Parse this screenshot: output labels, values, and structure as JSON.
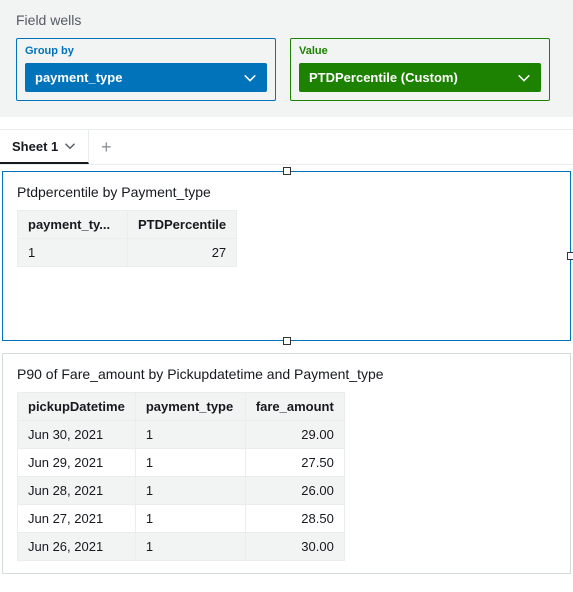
{
  "fieldWells": {
    "title": "Field wells",
    "groupBy": {
      "label": "Group by",
      "value": "payment_type"
    },
    "value": {
      "label": "Value",
      "value": "PTDPercentile (Custom)"
    }
  },
  "tabs": {
    "active": "Sheet 1",
    "addGlyph": "+"
  },
  "visual1": {
    "title": "Ptdpercentile by Payment_type",
    "headers": [
      "payment_ty...",
      "PTDPercentile"
    ],
    "rows": [
      {
        "payment_type": "1",
        "ptd": "27"
      }
    ]
  },
  "visual2": {
    "title": "P90 of Fare_amount by Pickupdatetime and Payment_type",
    "headers": [
      "pickupDatetime",
      "payment_type",
      "fare_amount"
    ],
    "rows": [
      {
        "d": "Jun 30, 2021",
        "p": "1",
        "f": "29.00"
      },
      {
        "d": "Jun 29, 2021",
        "p": "1",
        "f": "27.50"
      },
      {
        "d": "Jun 28, 2021",
        "p": "1",
        "f": "26.00"
      },
      {
        "d": "Jun 27, 2021",
        "p": "1",
        "f": "28.50"
      },
      {
        "d": "Jun 26, 2021",
        "p": "1",
        "f": "30.00"
      }
    ]
  },
  "chart_data": [
    {
      "type": "table",
      "title": "Ptdpercentile by Payment_type",
      "columns": [
        "payment_type",
        "PTDPercentile"
      ],
      "rows": [
        [
          1,
          27
        ]
      ]
    },
    {
      "type": "table",
      "title": "P90 of Fare_amount by Pickupdatetime and Payment_type",
      "columns": [
        "pickupDatetime",
        "payment_type",
        "fare_amount"
      ],
      "rows": [
        [
          "Jun 30, 2021",
          1,
          29.0
        ],
        [
          "Jun 29, 2021",
          1,
          27.5
        ],
        [
          "Jun 28, 2021",
          1,
          26.0
        ],
        [
          "Jun 27, 2021",
          1,
          28.5
        ],
        [
          "Jun 26, 2021",
          1,
          30.0
        ]
      ]
    }
  ]
}
